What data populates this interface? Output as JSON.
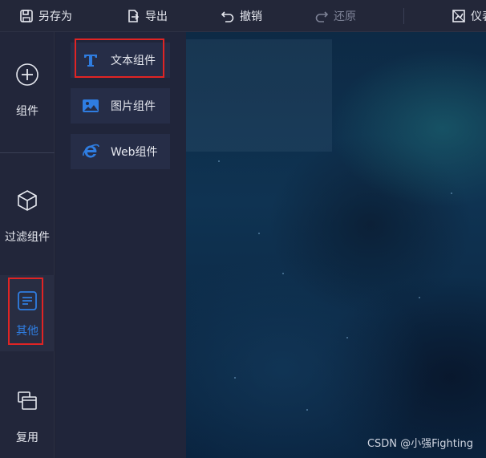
{
  "toolbar": {
    "save_as": "另存为",
    "export": "导出",
    "undo": "撤销",
    "redo": "还原",
    "dashboard_partial": "仪表"
  },
  "leftnav": {
    "items": [
      {
        "label": "组件",
        "icon": "plus-circle-icon"
      },
      {
        "label": "过滤组件",
        "icon": "cube-icon"
      },
      {
        "label": "其他",
        "icon": "list-card-icon",
        "active": true
      },
      {
        "label": "复用",
        "icon": "stacked-windows-icon"
      }
    ]
  },
  "panel": {
    "components": [
      {
        "label": "文本组件",
        "icon": "text-t-icon"
      },
      {
        "label": "图片组件",
        "icon": "image-icon"
      },
      {
        "label": "Web组件",
        "icon": "web-e-icon"
      }
    ]
  },
  "watermark": "CSDN @小强Fighting",
  "colors": {
    "accent": "#2f7de1",
    "highlight_border": "#e02424",
    "toolbar_bg": "#232739",
    "sidebar_bg": "#22263a",
    "panel_bg": "#20253a"
  }
}
